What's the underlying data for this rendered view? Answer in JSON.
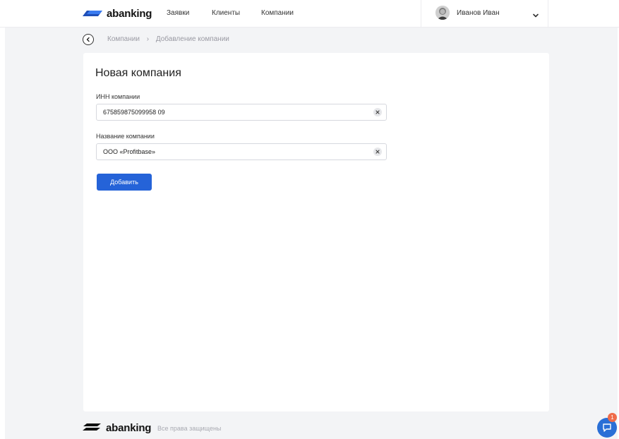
{
  "brand": {
    "name": "abanking"
  },
  "nav": {
    "items": [
      "Заявки",
      "Клиенты",
      "Компании"
    ]
  },
  "user": {
    "name": "Иванов Иван"
  },
  "breadcrumb": {
    "items": [
      "Компании",
      "Добавление компании"
    ]
  },
  "form": {
    "title": "Новая компания",
    "inn": {
      "label": "ИНН компании",
      "value": "675859875099958 09"
    },
    "name": {
      "label": "Название компании",
      "value": "ООО «Profitbase»"
    },
    "submit_label": "Добавить"
  },
  "footer": {
    "copyright": "Все права защищены"
  },
  "chat": {
    "badge_count": "1"
  },
  "colors": {
    "accent": "#2563d8",
    "badge": "#ef6c4a",
    "background": "#f3f4f6"
  }
}
